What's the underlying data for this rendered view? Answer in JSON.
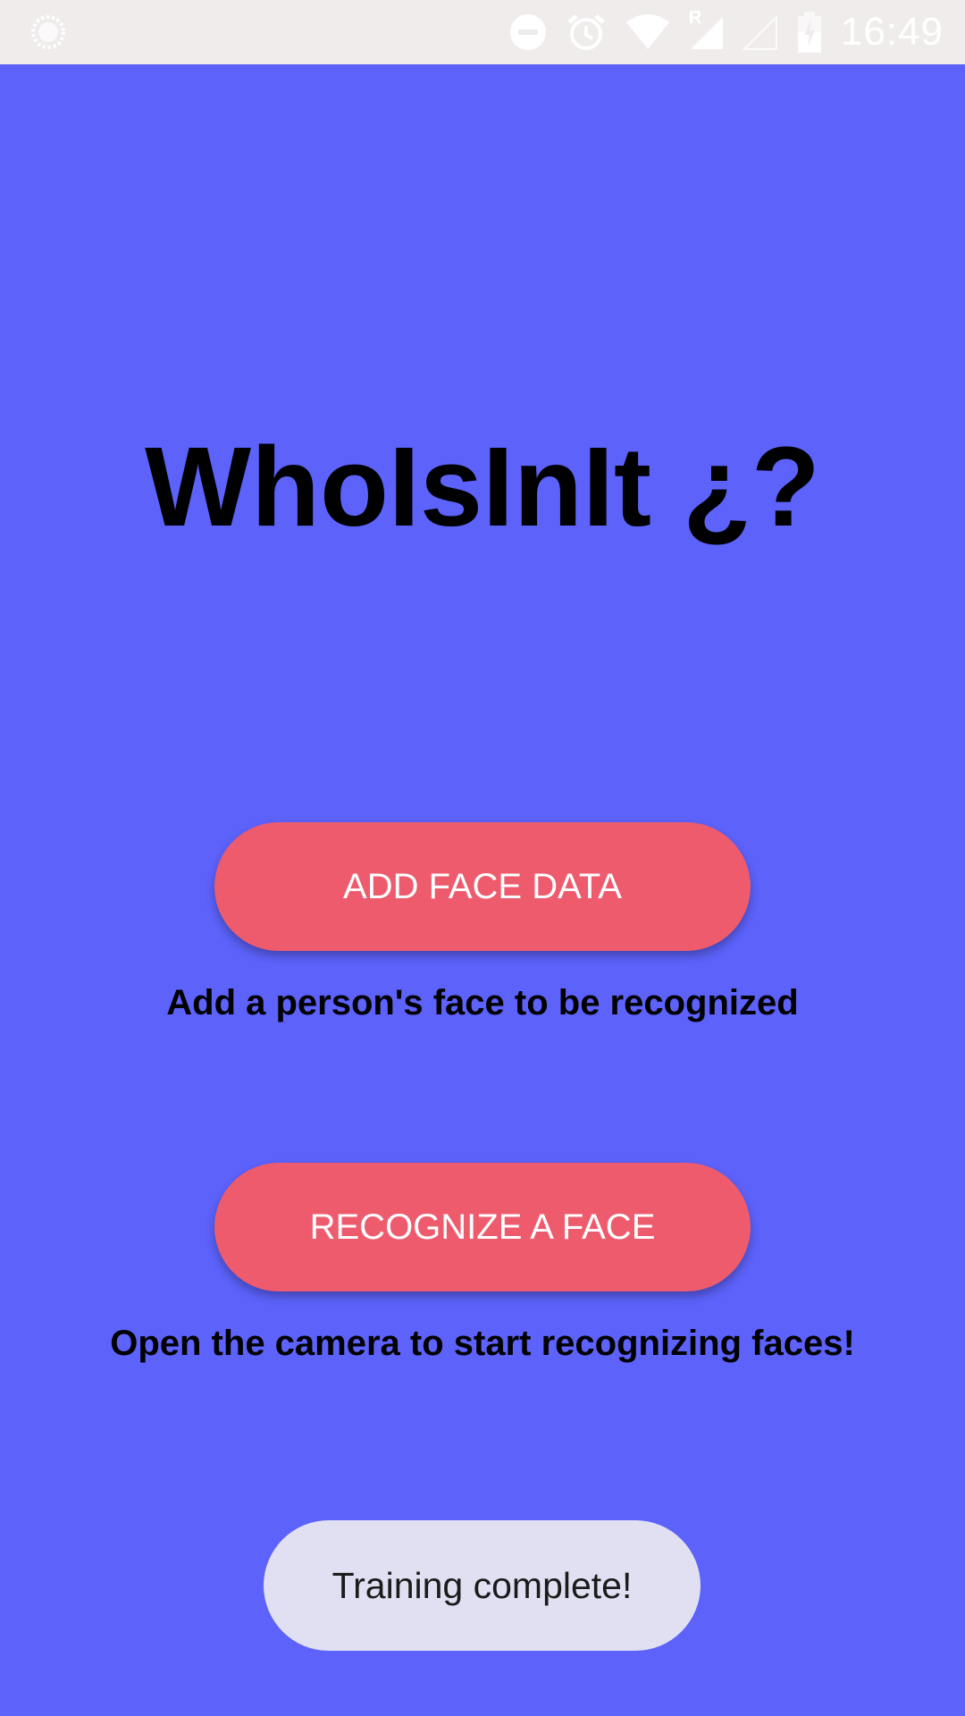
{
  "status_bar": {
    "time": "16:49",
    "icons": [
      "app-notification-icon",
      "do-not-disturb-icon",
      "alarm-icon",
      "wifi-icon",
      "signal-roaming-icon",
      "signal-empty-icon",
      "battery-charging-icon"
    ],
    "roaming_label": "R"
  },
  "main": {
    "title": "WhoIsInIt ¿?",
    "add_button_label": "ADD FACE DATA",
    "add_caption": "Add a person's face to be recognized",
    "recognize_button_label": "RECOGNIZE A FACE",
    "recognize_caption": "Open the camera to start recognizing faces!"
  },
  "toast": {
    "message": "Training complete!"
  },
  "colors": {
    "background": "#5c62fa",
    "button": "#ee5b6d",
    "status_bar": "#f0eceb",
    "toast": "#e0e0f2"
  }
}
